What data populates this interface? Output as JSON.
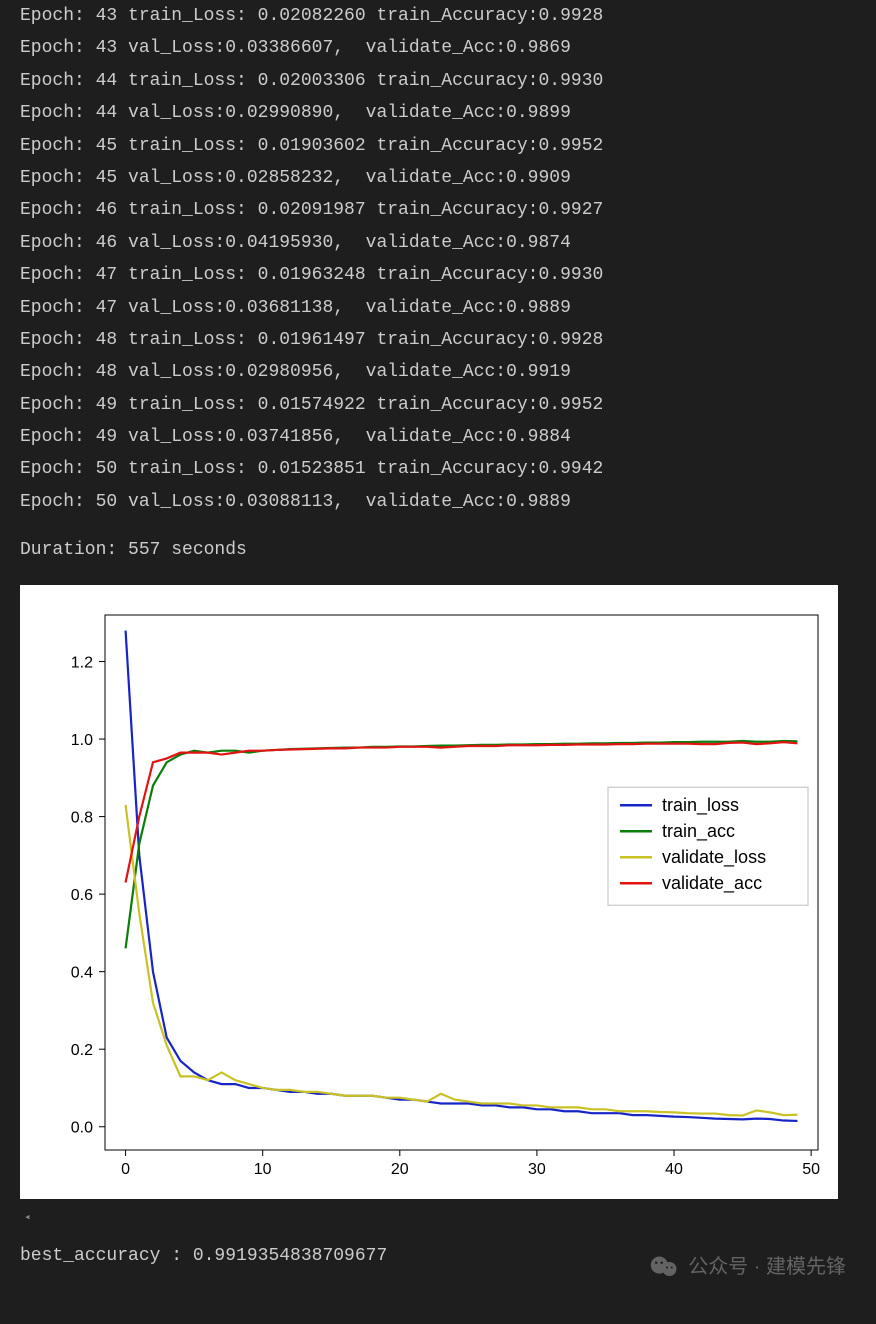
{
  "log_lines": [
    "Epoch: 43 train_Loss: 0.02082260 train_Accuracy:0.9928",
    "Epoch: 43 val_Loss:0.03386607,  validate_Acc:0.9869",
    "Epoch: 44 train_Loss: 0.02003306 train_Accuracy:0.9930",
    "Epoch: 44 val_Loss:0.02990890,  validate_Acc:0.9899",
    "Epoch: 45 train_Loss: 0.01903602 train_Accuracy:0.9952",
    "Epoch: 45 val_Loss:0.02858232,  validate_Acc:0.9909",
    "Epoch: 46 train_Loss: 0.02091987 train_Accuracy:0.9927",
    "Epoch: 46 val_Loss:0.04195930,  validate_Acc:0.9874",
    "Epoch: 47 train_Loss: 0.01963248 train_Accuracy:0.9930",
    "Epoch: 47 val_Loss:0.03681138,  validate_Acc:0.9889",
    "Epoch: 48 train_Loss: 0.01961497 train_Accuracy:0.9928",
    "Epoch: 48 val_Loss:0.02980956,  validate_Acc:0.9919",
    "Epoch: 49 train_Loss: 0.01574922 train_Accuracy:0.9952",
    "Epoch: 49 val_Loss:0.03741856,  validate_Acc:0.9884",
    "Epoch: 50 train_Loss: 0.01523851 train_Accuracy:0.9942",
    "Epoch: 50 val_Loss:0.03088113,  validate_Acc:0.9889"
  ],
  "duration_line": "Duration: 557 seconds",
  "best_line": "best_accuracy : 0.9919354838709677",
  "watermark": {
    "label": "公众号 · 建模先锋"
  },
  "chart_data": {
    "type": "line",
    "x": [
      0,
      1,
      2,
      3,
      4,
      5,
      6,
      7,
      8,
      9,
      10,
      11,
      12,
      13,
      14,
      15,
      16,
      17,
      18,
      19,
      20,
      21,
      22,
      23,
      24,
      25,
      26,
      27,
      28,
      29,
      30,
      31,
      32,
      33,
      34,
      35,
      36,
      37,
      38,
      39,
      40,
      41,
      42,
      43,
      44,
      45,
      46,
      47,
      48,
      49
    ],
    "series": [
      {
        "name": "train_loss",
        "color": "#1725c7",
        "values": [
          1.28,
          0.7,
          0.4,
          0.23,
          0.17,
          0.14,
          0.12,
          0.11,
          0.11,
          0.1,
          0.1,
          0.095,
          0.09,
          0.09,
          0.085,
          0.085,
          0.08,
          0.08,
          0.08,
          0.075,
          0.07,
          0.07,
          0.065,
          0.06,
          0.06,
          0.06,
          0.055,
          0.055,
          0.05,
          0.05,
          0.045,
          0.045,
          0.04,
          0.04,
          0.035,
          0.035,
          0.035,
          0.03,
          0.03,
          0.028,
          0.026,
          0.025,
          0.023,
          0.021,
          0.02,
          0.019,
          0.021,
          0.02,
          0.016,
          0.015
        ]
      },
      {
        "name": "train_acc",
        "color": "#0b7d0b",
        "values": [
          0.46,
          0.73,
          0.88,
          0.94,
          0.96,
          0.97,
          0.965,
          0.97,
          0.97,
          0.965,
          0.97,
          0.972,
          0.974,
          0.975,
          0.976,
          0.977,
          0.978,
          0.978,
          0.98,
          0.98,
          0.981,
          0.981,
          0.982,
          0.983,
          0.983,
          0.984,
          0.985,
          0.985,
          0.986,
          0.986,
          0.987,
          0.987,
          0.988,
          0.988,
          0.989,
          0.989,
          0.99,
          0.99,
          0.991,
          0.991,
          0.992,
          0.992,
          0.993,
          0.993,
          0.993,
          0.995,
          0.993,
          0.993,
          0.995,
          0.994
        ]
      },
      {
        "name": "validate_loss",
        "color": "#c9c227",
        "values": [
          0.83,
          0.55,
          0.32,
          0.21,
          0.13,
          0.13,
          0.12,
          0.14,
          0.12,
          0.11,
          0.1,
          0.095,
          0.095,
          0.09,
          0.09,
          0.085,
          0.08,
          0.08,
          0.08,
          0.075,
          0.075,
          0.07,
          0.065,
          0.085,
          0.07,
          0.065,
          0.06,
          0.06,
          0.06,
          0.055,
          0.055,
          0.05,
          0.05,
          0.05,
          0.045,
          0.045,
          0.04,
          0.04,
          0.04,
          0.038,
          0.037,
          0.035,
          0.034,
          0.034,
          0.03,
          0.029,
          0.042,
          0.037,
          0.03,
          0.031
        ]
      },
      {
        "name": "validate_acc",
        "color": "#e11313",
        "values": [
          0.63,
          0.8,
          0.94,
          0.95,
          0.965,
          0.965,
          0.965,
          0.96,
          0.965,
          0.97,
          0.97,
          0.972,
          0.973,
          0.974,
          0.975,
          0.976,
          0.976,
          0.978,
          0.978,
          0.978,
          0.98,
          0.98,
          0.98,
          0.978,
          0.98,
          0.982,
          0.982,
          0.982,
          0.984,
          0.984,
          0.984,
          0.985,
          0.985,
          0.986,
          0.986,
          0.986,
          0.987,
          0.987,
          0.988,
          0.988,
          0.988,
          0.988,
          0.987,
          0.987,
          0.99,
          0.991,
          0.987,
          0.989,
          0.992,
          0.989
        ]
      }
    ],
    "xlim": [
      -1.5,
      50.5
    ],
    "ylim": [
      -0.06,
      1.32
    ],
    "xticks": [
      0,
      10,
      20,
      30,
      40,
      50
    ],
    "yticks": [
      0.0,
      0.2,
      0.4,
      0.6,
      0.8,
      1.0,
      1.2
    ],
    "legend": [
      "train_loss",
      "train_acc",
      "validate_loss",
      "validate_acc"
    ],
    "legend_pos": "right"
  }
}
